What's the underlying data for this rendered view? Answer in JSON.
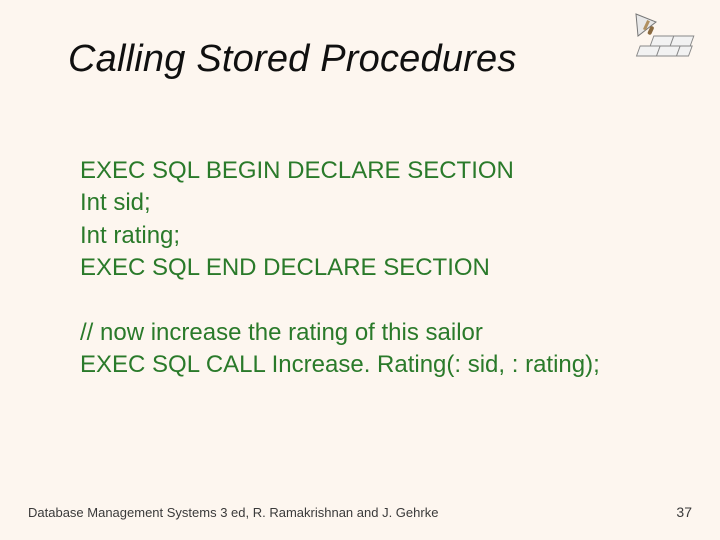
{
  "title": "Calling Stored Procedures",
  "code": {
    "l1": "EXEC SQL BEGIN DECLARE SECTION",
    "l2": "Int sid;",
    "l3": "Int rating;",
    "l4": "EXEC SQL END DECLARE SECTION",
    "l5": "// now increase the rating of this sailor",
    "l6": "EXEC SQL CALL Increase. Rating(: sid, : rating);"
  },
  "footer": {
    "left": "Database Management Systems 3 ed,  R. Ramakrishnan and J. Gehrke",
    "right": "37"
  }
}
